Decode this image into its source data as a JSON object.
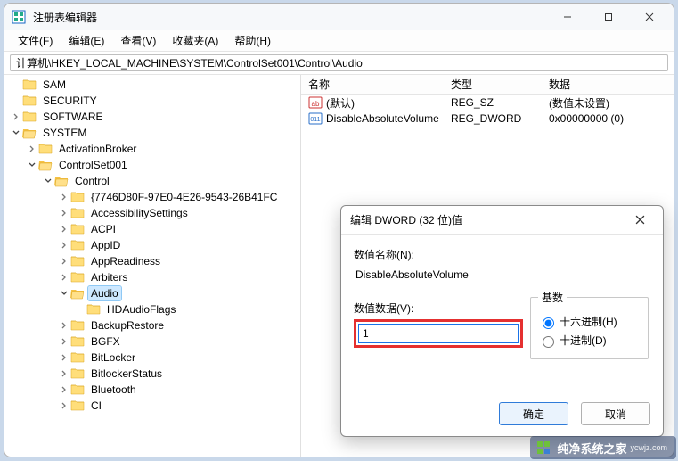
{
  "window": {
    "title": "注册表编辑器"
  },
  "menu": {
    "file": "文件(F)",
    "edit": "编辑(E)",
    "view": "查看(V)",
    "fav": "收藏夹(A)",
    "help": "帮助(H)"
  },
  "addressbar": {
    "path": "计算机\\HKEY_LOCAL_MACHINE\\SYSTEM\\ControlSet001\\Control\\Audio"
  },
  "tree": {
    "items": [
      {
        "level": 1,
        "expand": "",
        "label": "SAM"
      },
      {
        "level": 1,
        "expand": "",
        "label": "SECURITY"
      },
      {
        "level": 1,
        "expand": "closed",
        "label": "SOFTWARE"
      },
      {
        "level": 1,
        "expand": "open",
        "label": "SYSTEM"
      },
      {
        "level": 2,
        "expand": "closed",
        "label": "ActivationBroker"
      },
      {
        "level": 2,
        "expand": "open",
        "label": "ControlSet001"
      },
      {
        "level": 3,
        "expand": "open",
        "label": "Control"
      },
      {
        "level": 4,
        "expand": "closed",
        "label": "{7746D80F-97E0-4E26-9543-26B41FC"
      },
      {
        "level": 4,
        "expand": "closed",
        "label": "AccessibilitySettings"
      },
      {
        "level": 4,
        "expand": "closed",
        "label": "ACPI"
      },
      {
        "level": 4,
        "expand": "closed",
        "label": "AppID"
      },
      {
        "level": 4,
        "expand": "closed",
        "label": "AppReadiness"
      },
      {
        "level": 4,
        "expand": "closed",
        "label": "Arbiters"
      },
      {
        "level": 4,
        "expand": "open",
        "label": "Audio",
        "selected": true
      },
      {
        "level": 5,
        "expand": "",
        "label": "HDAudioFlags"
      },
      {
        "level": 4,
        "expand": "closed",
        "label": "BackupRestore"
      },
      {
        "level": 4,
        "expand": "closed",
        "label": "BGFX"
      },
      {
        "level": 4,
        "expand": "closed",
        "label": "BitLocker"
      },
      {
        "level": 4,
        "expand": "closed",
        "label": "BitlockerStatus"
      },
      {
        "level": 4,
        "expand": "closed",
        "label": "Bluetooth"
      },
      {
        "level": 4,
        "expand": "closed",
        "label": "CI"
      }
    ]
  },
  "list": {
    "cols": {
      "name": "名称",
      "type": "类型",
      "data": "数据"
    },
    "rows": [
      {
        "icon": "str",
        "name": "(默认)",
        "type": "REG_SZ",
        "data": "(数值未设置)"
      },
      {
        "icon": "dw",
        "name": "DisableAbsoluteVolume",
        "type": "REG_DWORD",
        "data": "0x00000000 (0)"
      }
    ]
  },
  "dialog": {
    "title": "编辑 DWORD (32 位)值",
    "name_label": "数值名称(N):",
    "name_value": "DisableAbsoluteVolume",
    "data_label": "数值数据(V):",
    "data_value": "1",
    "radix_label": "基数",
    "radix_hex": "十六进制(H)",
    "radix_dec": "十进制(D)",
    "ok": "确定",
    "cancel": "取消"
  },
  "watermark": {
    "text": "纯净系统之家",
    "sub": "ycwjz.com"
  }
}
